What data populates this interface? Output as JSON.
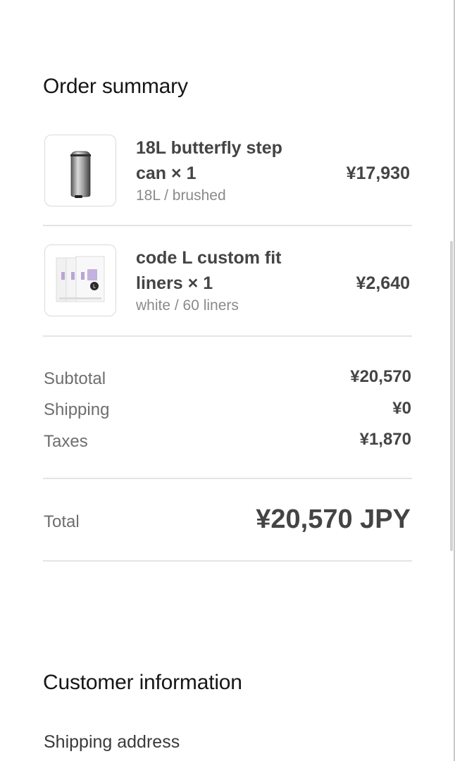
{
  "order_summary": {
    "title": "Order summary",
    "items": [
      {
        "name": "18L butterfly step can × 1",
        "variant": "18L / brushed",
        "price": "¥17,930",
        "thumbnail": "step-can-image"
      },
      {
        "name": "code L custom fit liners × 1",
        "variant": "white / 60 liners",
        "price": "¥2,640",
        "thumbnail": "liners-pack-image"
      }
    ],
    "totals": {
      "subtotal_label": "Subtotal",
      "subtotal_value": "¥20,570",
      "shipping_label": "Shipping",
      "shipping_value": "¥0",
      "taxes_label": "Taxes",
      "taxes_value": "¥1,870",
      "total_label": "Total",
      "total_value": "¥20,570 JPY"
    }
  },
  "customer_information": {
    "title": "Customer information",
    "shipping_address_label": "Shipping address"
  },
  "colors": {
    "heading": "#161616",
    "text_strong": "#444444",
    "text_muted": "#6e6e6e",
    "divider": "#e4e4e4"
  }
}
